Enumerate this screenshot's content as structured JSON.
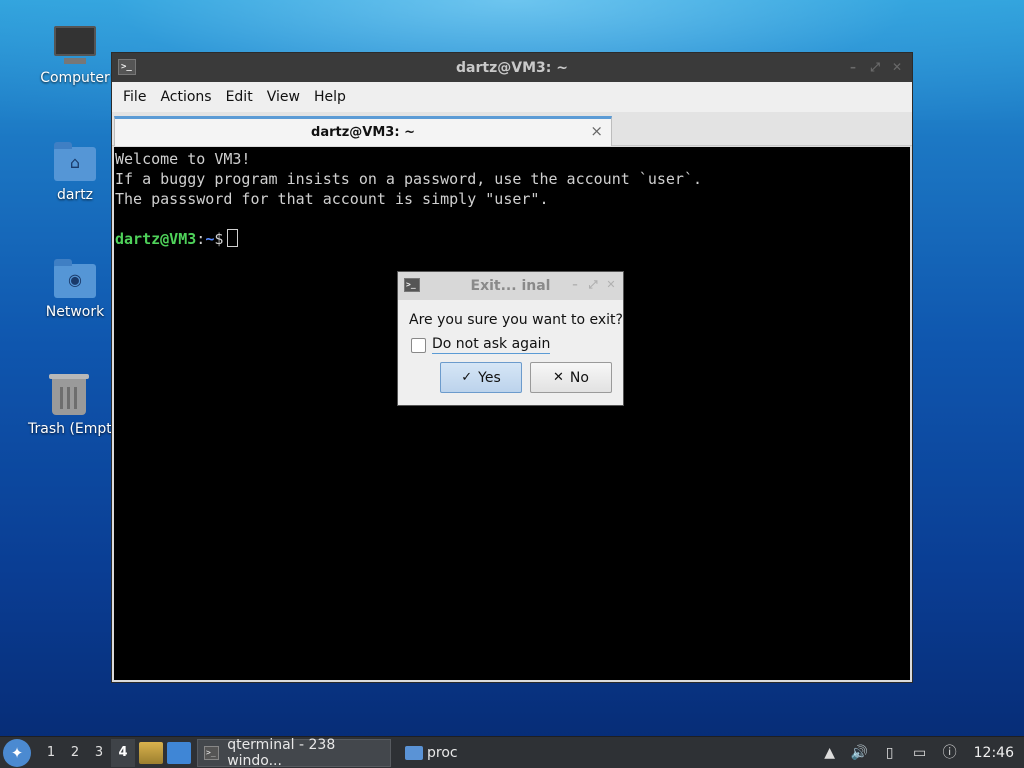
{
  "desktop": {
    "icons": [
      {
        "label": "Computer",
        "icon": "computer-icon"
      },
      {
        "label": "dartz",
        "icon": "home-folder-icon"
      },
      {
        "label": "Network",
        "icon": "network-folder-icon"
      },
      {
        "label": "Trash (Empt",
        "icon": "trash-icon"
      }
    ]
  },
  "window": {
    "title": "dartz@VM3: ~",
    "menu": [
      "File",
      "Actions",
      "Edit",
      "View",
      "Help"
    ],
    "tab": {
      "label": "dartz@VM3: ~",
      "close": "×"
    },
    "terminal": {
      "lines": [
        "Welcome to VM3!",
        "If a buggy program insists on a password, use the account `user`.",
        "The passsword for that account is simply \"user\"."
      ],
      "prompt_user": "dartz@VM3",
      "prompt_sep": ":",
      "prompt_path": "~",
      "prompt_symbol": "$"
    }
  },
  "dialog": {
    "title": "Exit... inal",
    "question": "Are you sure you want to exit?",
    "checkbox_label": "Do not ask again",
    "checkbox_checked": false,
    "yes_label": "Yes",
    "no_label": "No"
  },
  "taskbar": {
    "workspaces": [
      "1",
      "2",
      "3",
      "4"
    ],
    "active_workspace": "4",
    "tasks": [
      {
        "label": "qterminal - 238 windo...",
        "icon": "terminal-icon"
      },
      {
        "label": "proc",
        "icon": "folder-icon"
      }
    ],
    "clock": "12:46"
  }
}
